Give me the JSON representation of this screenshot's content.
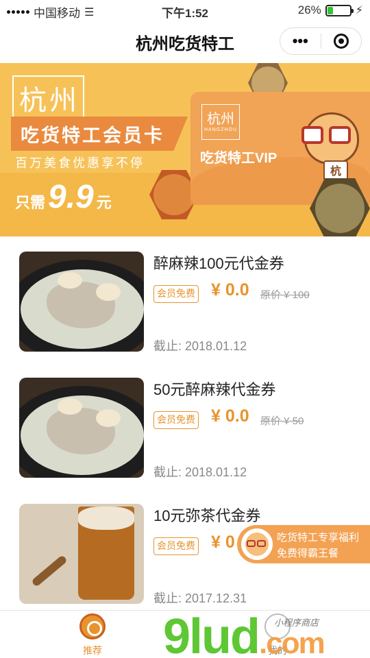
{
  "status_bar": {
    "carrier": "中国移动",
    "time": "下午1:52",
    "battery": "26%",
    "battery_level": 0.26
  },
  "nav": {
    "title": "杭州吃货特工",
    "more_label": "•••"
  },
  "banner": {
    "logo_text": "杭州",
    "card_title": "吃货特工会员卡",
    "subtitle": "百万美食优惠享不停",
    "price_prefix": "只需",
    "price_value": "9.9",
    "price_unit": "元",
    "vip_logo_cn": "杭州",
    "vip_logo_en": "HANGZHOU",
    "vip_label": "吃货特工VIP",
    "mascot_cup_text": "杭"
  },
  "coupons": [
    {
      "title": "醉麻辣100元代金券",
      "badge": "会员免费",
      "price": "¥ 0.0",
      "original": "原价 ¥ 100",
      "deadline": "截止: 2018.01.12"
    },
    {
      "title": "50元醉麻辣代金券",
      "badge": "会员免费",
      "price": "¥ 0.0",
      "original": "原价 ¥ 50",
      "deadline": "截止: 2018.01.12"
    },
    {
      "title": "10元弥茶代金券",
      "badge": "会员免费",
      "price": "¥ 0",
      "original": "",
      "deadline": "截止: 2017.12.31"
    }
  ],
  "promo": {
    "line1": "吃货特工专享福利",
    "line2": "免费得霸王餐"
  },
  "tabs": [
    {
      "label": "推荐",
      "icon": "recommend-icon",
      "active": true
    },
    {
      "label": "我的",
      "icon": "profile-icon",
      "active": false
    }
  ],
  "watermark": {
    "brand": "9lud",
    "domain": ".com",
    "small": "小程序商店"
  },
  "colors": {
    "accent": "#e8932d",
    "banner": "#f6c258",
    "vip_card": "#f1a356"
  }
}
